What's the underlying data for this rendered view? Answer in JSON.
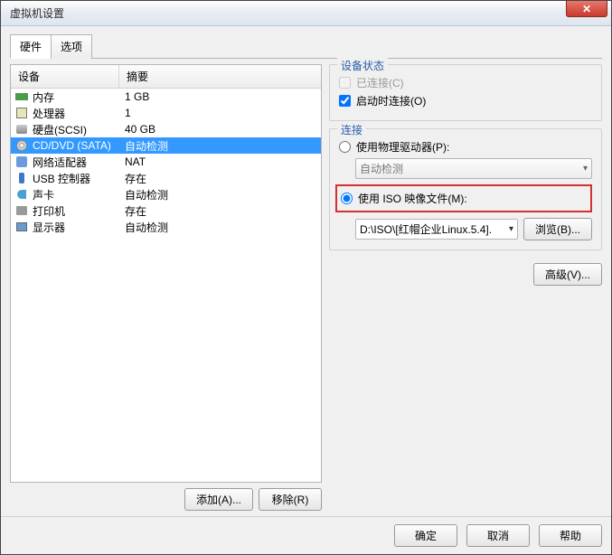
{
  "window": {
    "title": "虚拟机设置"
  },
  "tabs": {
    "hardware": "硬件",
    "options": "选项"
  },
  "hw_header": {
    "device": "设备",
    "summary": "摘要"
  },
  "hw": [
    {
      "name": "内存",
      "summary": "1 GB",
      "icon": "mem"
    },
    {
      "name": "处理器",
      "summary": "1",
      "icon": "cpu"
    },
    {
      "name": "硬盘(SCSI)",
      "summary": "40 GB",
      "icon": "hdd"
    },
    {
      "name": "CD/DVD (SATA)",
      "summary": "自动检测",
      "icon": "cd",
      "selected": true
    },
    {
      "name": "网络适配器",
      "summary": "NAT",
      "icon": "net"
    },
    {
      "name": "USB 控制器",
      "summary": "存在",
      "icon": "usb"
    },
    {
      "name": "声卡",
      "summary": "自动检测",
      "icon": "snd"
    },
    {
      "name": "打印机",
      "summary": "存在",
      "icon": "prt"
    },
    {
      "name": "显示器",
      "summary": "自动检测",
      "icon": "disp"
    }
  ],
  "buttons": {
    "add": "添加(A)...",
    "remove": "移除(R)",
    "browse": "浏览(B)...",
    "advanced": "高级(V)...",
    "ok": "确定",
    "cancel": "取消",
    "help": "帮助"
  },
  "device_status": {
    "legend": "设备状态",
    "connected": "已连接(C)",
    "connect_at_power_on": "启动时连接(O)"
  },
  "connection": {
    "legend": "连接",
    "use_physical": "使用物理驱动器(P):",
    "auto_detect": "自动检测",
    "use_iso": "使用 ISO 映像文件(M):",
    "iso_path": "D:\\ISO\\[红帽企业Linux.5.4]."
  }
}
